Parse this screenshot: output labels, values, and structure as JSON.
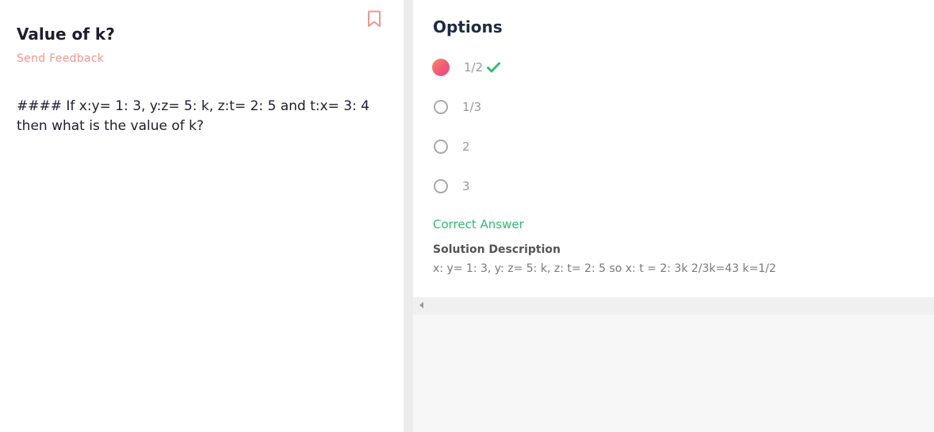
{
  "question": {
    "title": "Value of k?",
    "feedback_label": "Send Feedback",
    "text": "#### If x:y= 1: 3, y:z= 5: k, z:t= 2: 5 and t:x= 3: 4 then what is the value of k?",
    "bookmark_icon": "bookmark-icon"
  },
  "options": {
    "heading": "Options",
    "items": [
      {
        "label": "1/2",
        "selected": true,
        "correct": true
      },
      {
        "label": "1/3",
        "selected": false,
        "correct": false
      },
      {
        "label": "2",
        "selected": false,
        "correct": false
      },
      {
        "label": "3",
        "selected": false,
        "correct": false
      }
    ]
  },
  "result": {
    "status_label": "Correct Answer",
    "solution_heading": "Solution Description",
    "solution_text": "x: y= 1: 3, y: z= 5: k, z: t= 2: 5 so x: t = 2: 3k 2/3k=43 k=1/2"
  },
  "colors": {
    "accent": "#f4958f",
    "correct": "#2fbf6f",
    "selected_gradient_start": "#fb8a5a",
    "selected_gradient_end": "#ee4486"
  }
}
